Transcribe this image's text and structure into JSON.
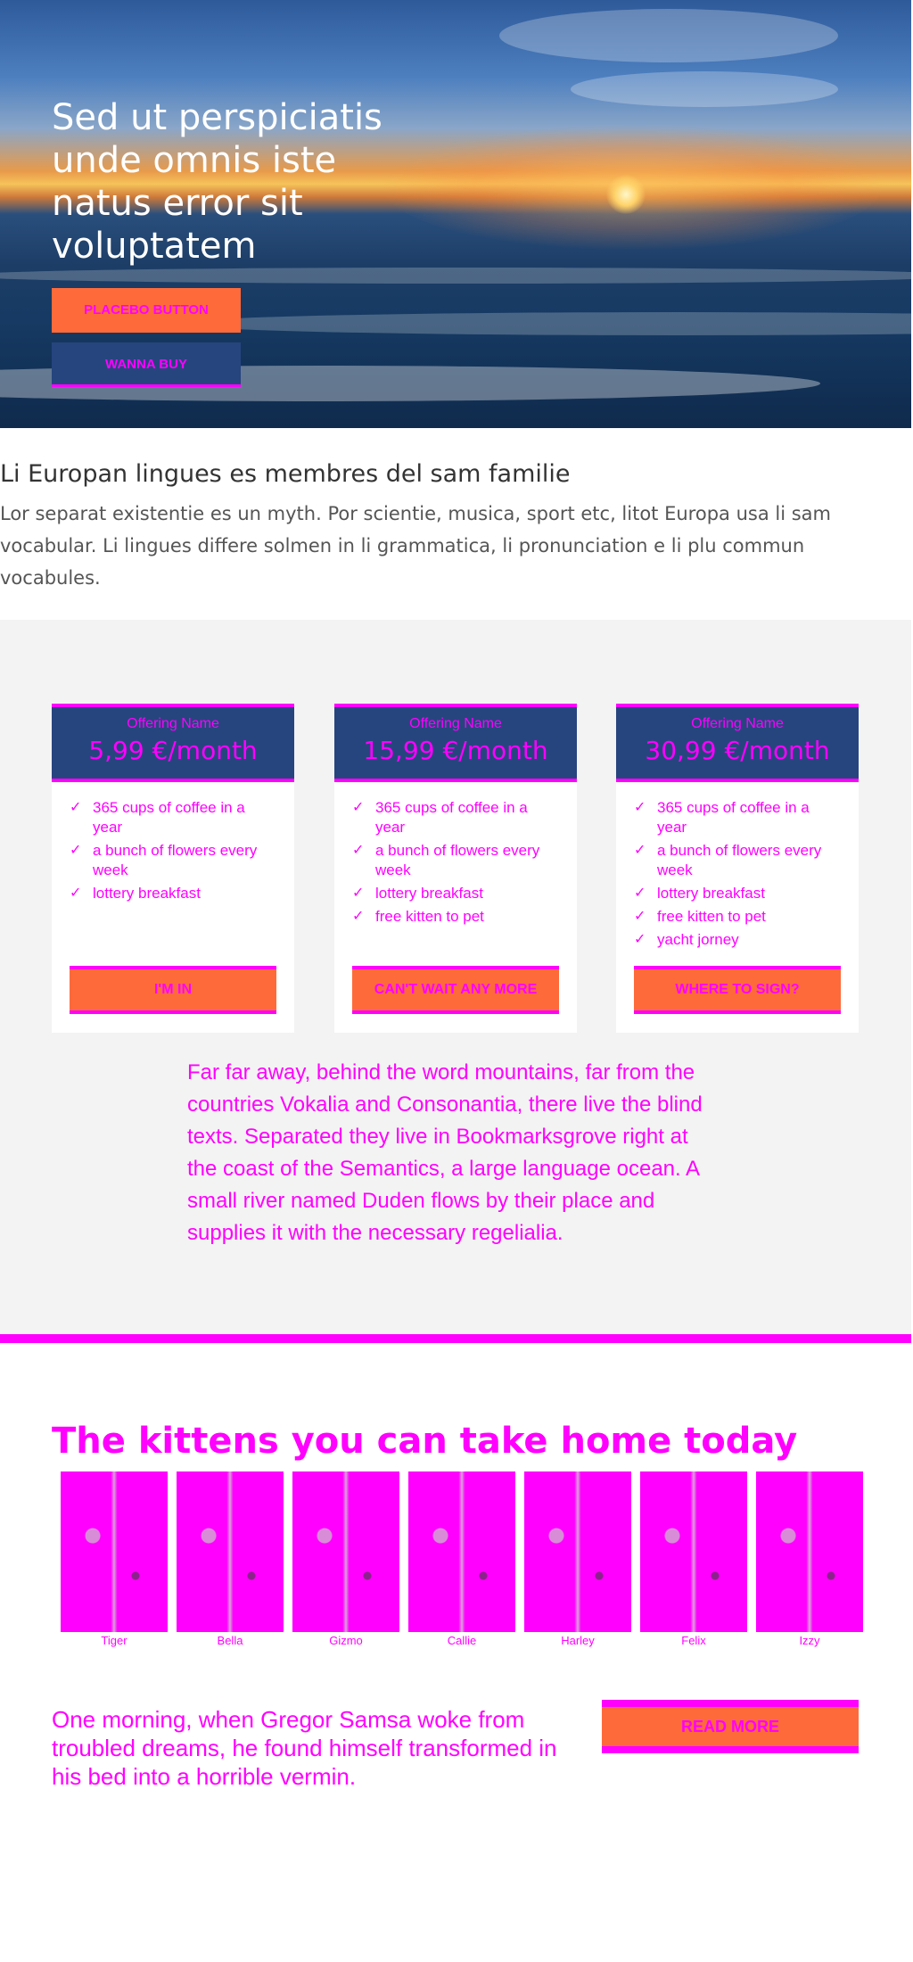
{
  "hero": {
    "title": "Sed ut perspiciatis unde omnis iste natus error sit voluptatem",
    "primary_button": "Placebo button",
    "secondary_button": "Wanna buy"
  },
  "intro": {
    "heading": "Li Europan lingues es membres del sam familie",
    "body": "Lor separat existentie es un myth. Por scientie, musica, sport etc, litot Europa usa li sam vocabular. Li lingues differe solmen in li grammatica, li pronunciation e li plu commun vocabules."
  },
  "pricing": {
    "plans": [
      {
        "offer_name": "Offering Name",
        "price": "5,99 €/month",
        "features": [
          "365 cups of coffee in a year",
          "a bunch of flowers every week",
          "lottery breakfast"
        ],
        "cta": "I'm in"
      },
      {
        "offer_name": "Offering Name",
        "price": "15,99 €/month",
        "features": [
          "365 cups of coffee in a year",
          "a bunch of flowers every week",
          "lottery breakfast",
          "free kitten to pet"
        ],
        "cta": "Can't wait any more"
      },
      {
        "offer_name": "Offering Name",
        "price": "30,99 €/month",
        "features": [
          "365 cups of coffee in a year",
          "a bunch of flowers every week",
          "lottery breakfast",
          "free kitten to pet",
          "yacht jorney"
        ],
        "cta": "Where to sign?"
      }
    ],
    "story": "Far far away, behind the word mountains, far from the countries Vokalia and Consonantia, there live the blind texts. Separated they live in Bookmarksgrove right at the coast of the Semantics, a large language ocean. A small river named Duden flows by their place and supplies it with the necessary regelialia."
  },
  "kittens": {
    "title": "The kittens you can take home today",
    "items": [
      "Tiger",
      "Bella",
      "Gizmo",
      "Callie",
      "Harley",
      "Felix",
      "Izzy"
    ]
  },
  "closing": {
    "text": "One morning, when Gregor Samsa woke from troubled dreams, he found himself transformed in his bed into a horrible vermin.",
    "button": "Read more"
  },
  "colors": {
    "accent": "#ff00ff",
    "cta_orange": "#ff6a3a",
    "navy": "#26457f",
    "panel_bg": "#f3f3f3"
  },
  "icons": {
    "feature_bullet": "check-icon"
  }
}
